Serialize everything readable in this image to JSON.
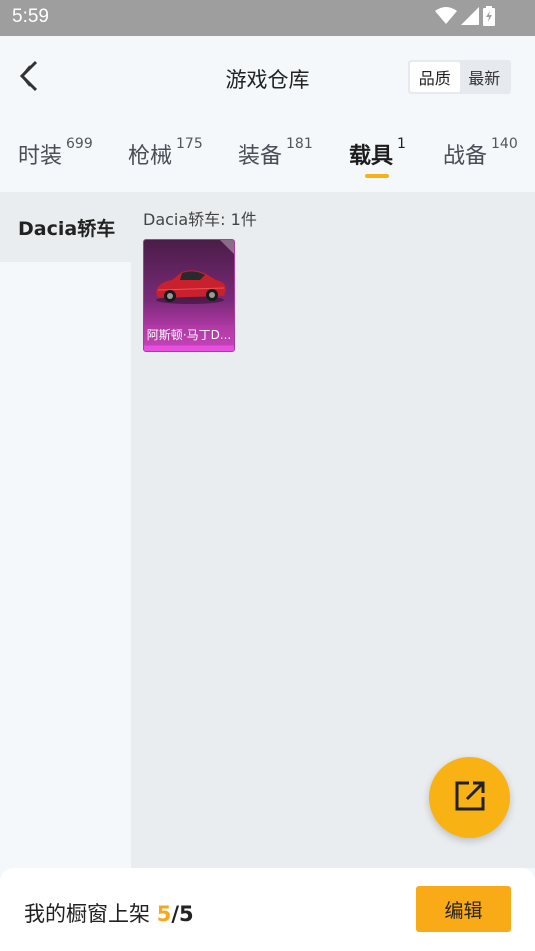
{
  "status_bar": {
    "time": "5:59",
    "icons": [
      "wifi-icon",
      "signal-icon",
      "battery-icon"
    ]
  },
  "header": {
    "title": "游戏仓库",
    "sort_options": [
      {
        "label": "品质",
        "selected": true
      },
      {
        "label": "最新",
        "selected": false
      }
    ]
  },
  "tabs": [
    {
      "label": "时装",
      "count": "699"
    },
    {
      "label": "枪械",
      "count": "175"
    },
    {
      "label": "装备",
      "count": "181"
    },
    {
      "label": "载具",
      "count": "1",
      "active": true
    },
    {
      "label": "战备",
      "count": "140"
    }
  ],
  "sidebar": {
    "items": [
      {
        "label": "Dacia轿车",
        "selected": true
      }
    ]
  },
  "content": {
    "group_title": "Dacia轿车: 1件",
    "items": [
      {
        "name": "阿斯顿·马丁D..."
      }
    ]
  },
  "fab": {
    "icon": "share-external-icon"
  },
  "footer": {
    "label": "我的橱窗上架",
    "count": "5",
    "separator": "/",
    "total": "5",
    "edit_label": "编辑"
  },
  "colors": {
    "accent": "#f8b214",
    "tab_indicator": "#f7b21a",
    "status_bar": "#9e9e9e",
    "item_rarity": "#d94fc9"
  }
}
